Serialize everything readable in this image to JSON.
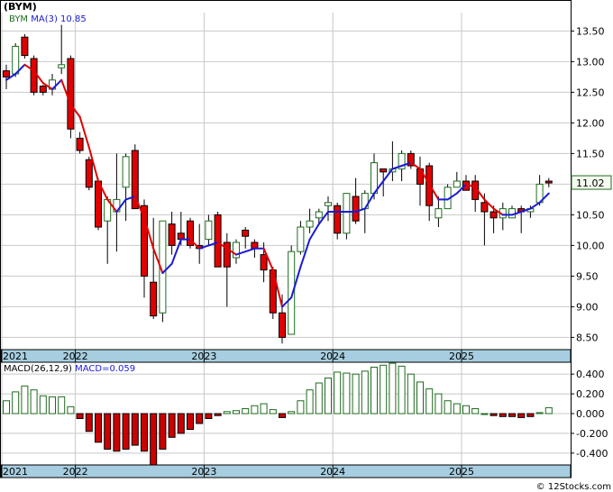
{
  "symbol": "(BYM)",
  "legend_price": {
    "series": "BYM",
    "ma": "MA(3)",
    "ma_value": "10.85"
  },
  "legend_macd": {
    "label": "MACD(26,12,9)",
    "value": "MACD=0.059"
  },
  "last_price": "11.02",
  "watermark": "© 12Stocks.com",
  "x_labels": [
    "2021",
    "2022",
    "2023",
    "2024",
    "2025"
  ],
  "colors": {
    "up": "#1f6b1f",
    "down": "#e00000",
    "ma_down": "#e00000",
    "ma_up": "#1a1ad6",
    "axis_band": "#a6cde0",
    "hist": "#1f6b1f",
    "hist_neg": "#cc0000",
    "grid": "#c8c8c8"
  },
  "chart_data": [
    {
      "type": "candlestick",
      "title": "(BYM)",
      "ylim": [
        8.3,
        13.8
      ],
      "yticks": [
        "8.50",
        "9.00",
        "9.50",
        "10.00",
        "10.50",
        "11.00",
        "11.50",
        "12.00",
        "12.50",
        "13.00",
        "13.50"
      ],
      "series": [
        {
          "name": "BYM",
          "candles": [
            [
              12.85,
              12.95,
              12.55,
              12.75
            ],
            [
              12.8,
              13.3,
              12.75,
              13.25
            ],
            [
              13.4,
              13.45,
              13.05,
              13.1
            ],
            [
              13.05,
              13.1,
              12.45,
              12.5
            ],
            [
              12.6,
              12.62,
              12.45,
              12.5
            ],
            [
              12.55,
              12.8,
              12.45,
              12.7
            ],
            [
              12.9,
              13.6,
              12.8,
              12.95
            ],
            [
              13.05,
              13.1,
              11.75,
              11.9
            ],
            [
              11.75,
              11.85,
              11.5,
              11.55
            ],
            [
              11.4,
              11.45,
              10.9,
              10.95
            ],
            [
              11.05,
              11.1,
              10.25,
              10.3
            ],
            [
              10.4,
              10.8,
              9.7,
              10.75
            ],
            [
              10.55,
              11.5,
              9.9,
              10.75
            ],
            [
              10.95,
              11.5,
              10.4,
              11.45
            ],
            [
              11.55,
              11.65,
              10.6,
              10.6
            ],
            [
              10.65,
              10.75,
              9.15,
              9.5
            ],
            [
              9.4,
              10.45,
              8.8,
              8.85
            ],
            [
              8.9,
              10.4,
              8.75,
              10.4
            ],
            [
              10.35,
              10.55,
              9.85,
              10.0
            ],
            [
              10.2,
              10.55,
              10.0,
              10.1
            ],
            [
              10.4,
              10.45,
              9.95,
              10.0
            ],
            [
              10.0,
              10.35,
              9.7,
              9.95
            ],
            [
              10.1,
              10.5,
              10.0,
              10.4
            ],
            [
              10.5,
              10.55,
              9.7,
              9.65
            ],
            [
              10.05,
              10.2,
              9.0,
              9.65
            ],
            [
              9.8,
              10.1,
              9.7,
              10.05
            ],
            [
              10.25,
              10.3,
              9.95,
              10.15
            ],
            [
              10.05,
              10.1,
              9.8,
              9.95
            ],
            [
              9.85,
              10.05,
              9.4,
              9.6
            ],
            [
              9.6,
              9.65,
              8.8,
              8.9
            ],
            [
              8.9,
              9.2,
              8.4,
              8.5
            ],
            [
              8.55,
              10.0,
              8.55,
              9.9
            ],
            [
              9.9,
              10.4,
              9.85,
              10.3
            ],
            [
              10.3,
              10.6,
              10.2,
              10.4
            ],
            [
              10.45,
              10.6,
              10.35,
              10.55
            ],
            [
              10.65,
              10.8,
              10.4,
              10.7
            ],
            [
              10.65,
              10.7,
              10.1,
              10.2
            ],
            [
              10.2,
              10.85,
              10.1,
              10.85
            ],
            [
              10.8,
              11.1,
              10.35,
              10.4
            ],
            [
              10.6,
              10.9,
              10.2,
              10.85
            ],
            [
              10.85,
              11.5,
              10.75,
              11.35
            ],
            [
              11.25,
              11.25,
              10.8,
              11.2
            ],
            [
              11.2,
              11.7,
              11.05,
              11.25
            ],
            [
              11.25,
              11.55,
              11.05,
              11.5
            ],
            [
              11.5,
              11.55,
              11.25,
              11.3
            ],
            [
              11.25,
              11.45,
              10.65,
              11.0
            ],
            [
              11.3,
              11.35,
              10.4,
              10.65
            ],
            [
              10.45,
              10.8,
              10.3,
              10.6
            ],
            [
              10.6,
              11.0,
              10.6,
              10.95
            ],
            [
              10.95,
              11.2,
              10.95,
              11.05
            ],
            [
              11.05,
              11.15,
              10.9,
              10.9
            ],
            [
              11.05,
              11.15,
              10.55,
              10.75
            ],
            [
              10.7,
              10.85,
              10.0,
              10.55
            ],
            [
              10.55,
              10.65,
              10.2,
              10.45
            ],
            [
              10.45,
              10.7,
              10.25,
              10.6
            ],
            [
              10.45,
              10.65,
              10.45,
              10.6
            ],
            [
              10.6,
              10.65,
              10.2,
              10.55
            ],
            [
              10.55,
              10.65,
              10.45,
              10.6
            ],
            [
              10.7,
              11.15,
              10.65,
              11.0
            ],
            [
              11.05,
              11.1,
              10.95,
              11.02
            ]
          ]
        },
        {
          "name": "MA(3)",
          "values": [
            12.7,
            12.8,
            12.95,
            12.85,
            12.65,
            12.55,
            12.7,
            12.3,
            12.1,
            11.6,
            11.05,
            10.75,
            10.55,
            10.75,
            10.8,
            10.45,
            9.95,
            9.55,
            9.7,
            10.1,
            10.1,
            9.95,
            10.0,
            10.05,
            9.95,
            9.85,
            9.9,
            9.95,
            9.95,
            9.6,
            9.0,
            9.15,
            9.65,
            10.1,
            10.35,
            10.55,
            10.55,
            10.55,
            10.55,
            10.6,
            10.85,
            11.05,
            11.25,
            11.3,
            11.35,
            11.25,
            11.0,
            10.75,
            10.75,
            10.85,
            11.0,
            10.95,
            10.75,
            10.6,
            10.5,
            10.5,
            10.55,
            10.6,
            10.7,
            10.85
          ]
        }
      ]
    },
    {
      "type": "bar",
      "title": "MACD(26,12,9)",
      "ylim": [
        -0.52,
        0.52
      ],
      "yticks": [
        "0.400",
        "0.200",
        "0.000",
        "-0.200",
        "-0.400"
      ],
      "series": [
        {
          "name": "MACD",
          "values": [
            0.13,
            0.22,
            0.28,
            0.24,
            0.18,
            0.17,
            0.17,
            0.07,
            -0.05,
            -0.18,
            -0.29,
            -0.36,
            -0.38,
            -0.36,
            -0.32,
            -0.38,
            -0.52,
            -0.36,
            -0.24,
            -0.2,
            -0.16,
            -0.1,
            -0.05,
            -0.02,
            0.02,
            0.03,
            0.05,
            0.08,
            0.1,
            0.04,
            -0.04,
            0.02,
            0.13,
            0.24,
            0.31,
            0.36,
            0.42,
            0.41,
            0.4,
            0.43,
            0.47,
            0.49,
            0.51,
            0.48,
            0.4,
            0.32,
            0.25,
            0.2,
            0.13,
            0.1,
            0.08,
            0.05,
            0.0,
            -0.02,
            -0.03,
            -0.03,
            -0.04,
            -0.03,
            0.01,
            0.06
          ]
        }
      ]
    }
  ]
}
